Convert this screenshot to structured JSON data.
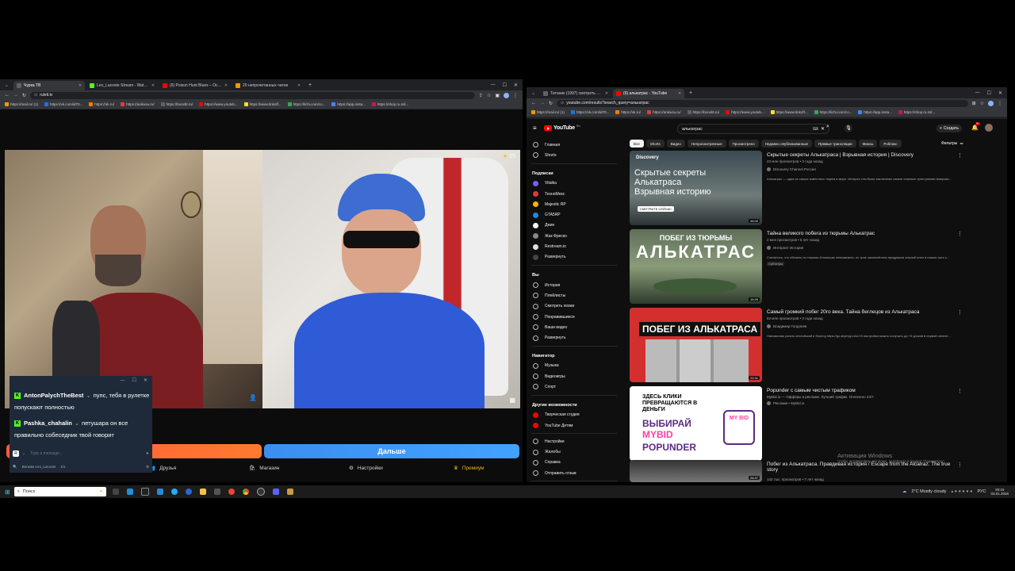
{
  "left_browser": {
    "tabs": [
      {
        "label": "Чурка ТВ",
        "color": "#5f6368",
        "active": true
      },
      {
        "label": "Leo_Lacoste Stream - Watch Li...",
        "color": "#53fc18"
      },
      {
        "label": "(6) Poison Hunt Blues – Осм...",
        "color": "#ff0000"
      },
      {
        "label": "20 непрочитанных чатов",
        "color": "#f29900"
      }
    ],
    "url": "ruletl.tv",
    "bookmarks": [
      "https://mail.ru/ (1)",
      "https://vk.com/id70...",
      "https://ok.ru/",
      "https://anikusu.ru/",
      "https://boosbt.ru/",
      "https://www.youtub...",
      "https://www.tinkoff...",
      "https://lichi.com/co...",
      "https://app.insta...",
      "https://shop.ru.mil..."
    ]
  },
  "roulette": {
    "star_count": "25",
    "next_label": "",
    "skip_label": "Дальше",
    "menu": {
      "friends": "Друзья",
      "shop": "Магазин",
      "settings": "Настройки",
      "premium": "Премиум"
    }
  },
  "chat": {
    "messages": [
      {
        "user": "AntonPalychTheBest",
        "text": "пупс, тебя в рулетке попускают полностью"
      },
      {
        "user": "Pashka_chahalin",
        "text": "петушара он все правильно собеседник твой говорит"
      }
    ],
    "input_placeholder": "Type a message...",
    "footer_name": "Велкам Leo_Lacoste",
    "footer_count": "1/1"
  },
  "right_browser": {
    "tabs": [
      {
        "label": "Титаник (1997) смотреть онл...",
        "color": "#5f6368"
      },
      {
        "label": "(6) алькатрас - YouTube",
        "color": "#ff0000",
        "active": true
      }
    ],
    "url": "youtube.com/results?search_query=алькатрас",
    "bookmarks": [
      "https://mail.ru/ (1)",
      "https://vk.com/id70...",
      "https://ok.ru/",
      "https://anikusu.ru/",
      "https://boosbt.ru/",
      "https://www.youtub...",
      "https://www.tinkoff...",
      "https://lichi.com/co...",
      "https://app.insta...",
      "https://shop.ru.mil..."
    ]
  },
  "youtube": {
    "logo": "YouTube",
    "country": "RU",
    "search_value": "алькатрас",
    "create_label": "Создать",
    "notif_count": "9+",
    "nav_main": [
      "Главная",
      "Shorts"
    ],
    "subs_title": "Подписки",
    "subscriptions": [
      "Vitalka",
      "ТехноМекс",
      "Majestic RP",
      "GTA5RP",
      "Джин",
      "Жак Фреско",
      "Restream.io",
      "Развернуть"
    ],
    "you_title": "Вы",
    "you_items": [
      "История",
      "Плейлисты",
      "Смотреть позже",
      "Понравившиеся",
      "Ваши видео",
      "Развернуть"
    ],
    "nav_title": "Навигатор",
    "nav_items": [
      "Музыка",
      "Видеоигры",
      "Спорт"
    ],
    "more_title": "Другие возможности",
    "more_items": [
      "Творческая студия",
      "YouTube Детям"
    ],
    "bottom_items": [
      "Настройки",
      "Жалобы",
      "Справка",
      "Отправить отзыв"
    ],
    "chips": [
      "Все",
      "Shorts",
      "Видео",
      "Непросмотренные",
      "Просмотрено",
      "Недавно опубликованные",
      "Прямые трансляции",
      "Миксы",
      "Роблокс"
    ],
    "filters_label": "Фильтры",
    "videos": [
      {
        "title": "Скрытые секреты Алькатраса | Взрывная история | Discovery",
        "meta": "23 млн просмотров • 3 года назад",
        "channel": "Discovery Channel Россия",
        "desc": "Алькатрас — одна из самых известных тюрем в мире. Интерес тем были заключены самые опасные преступники Америки...",
        "thumb_text": "Скрытые секреты Алькатраса Взрывная историю",
        "thumb_top": "Discovery",
        "thumb_badge": "СМОТРИТЕ СЕЙЧАС",
        "duration": "44:02"
      },
      {
        "title": "Тайна великого побега из тюрьмы Алькатрас",
        "meta": "2 млн просмотров • 5 лет назад",
        "channel": "Интернет История",
        "desc": "Считалось, что сбежать из тюрьмы Алькатрас невозможно, но трое заключённых придумали хитрый план и нашли путь к...",
        "tag": "Субтитры",
        "thumb_top": "ПОБЕГ ИЗ ТЮРЬМЫ",
        "thumb_text": "АЛЬКАТРАС",
        "duration": "19:29"
      },
      {
        "title": "Самый громкий побег 20го века. Тайна беглецов из Алькатраса",
        "meta": "63 млн просмотров • 3 года назад",
        "channel": "Владимир Голдлеев",
        "desc": "Напоминаю узнать английский в Skyeng https://go.skyeng.ru/s/J В настройки можно получить до +5 уроков в первой оплате...",
        "thumb_text": "ПОБЕГ ИЗ АЛЬКАТРАСА",
        "duration": "22:11"
      },
      {
        "title": "Popunder с самым чистым трафиком",
        "meta": "MyBid.io — Офферы в рекламе. Лучший трафик. Оплачено 24/7.",
        "channel": "Реклама • MyBid.io",
        "thumb_text": "ЗДЕСЬ КЛИКИ ПРЕВРАЩАЮТСЯ В ДЕНЬГИ",
        "thumb_cta": "ВЫБИРАЙ",
        "thumb_brand": "MYBID",
        "thumb_sub": "POPUNDER",
        "logo_text": "MY BID"
      },
      {
        "title": "Побег из Алькатраса. Правдивая история / Escape from the Alcatraz. The true story",
        "meta": "142 тыс. просмотров • 7 лет назад",
        "duration": "26:37"
      }
    ],
    "activation_title": "Активация Windows",
    "activation_sub": "Чтобы активировать Windows, перейдите в раздел \"Параметры\"."
  },
  "taskbar": {
    "search_placeholder": "Поиск",
    "weather": "2°C  Mostly cloudy",
    "lang": "РУС",
    "time": "20:15",
    "date": "03.01.2026"
  }
}
